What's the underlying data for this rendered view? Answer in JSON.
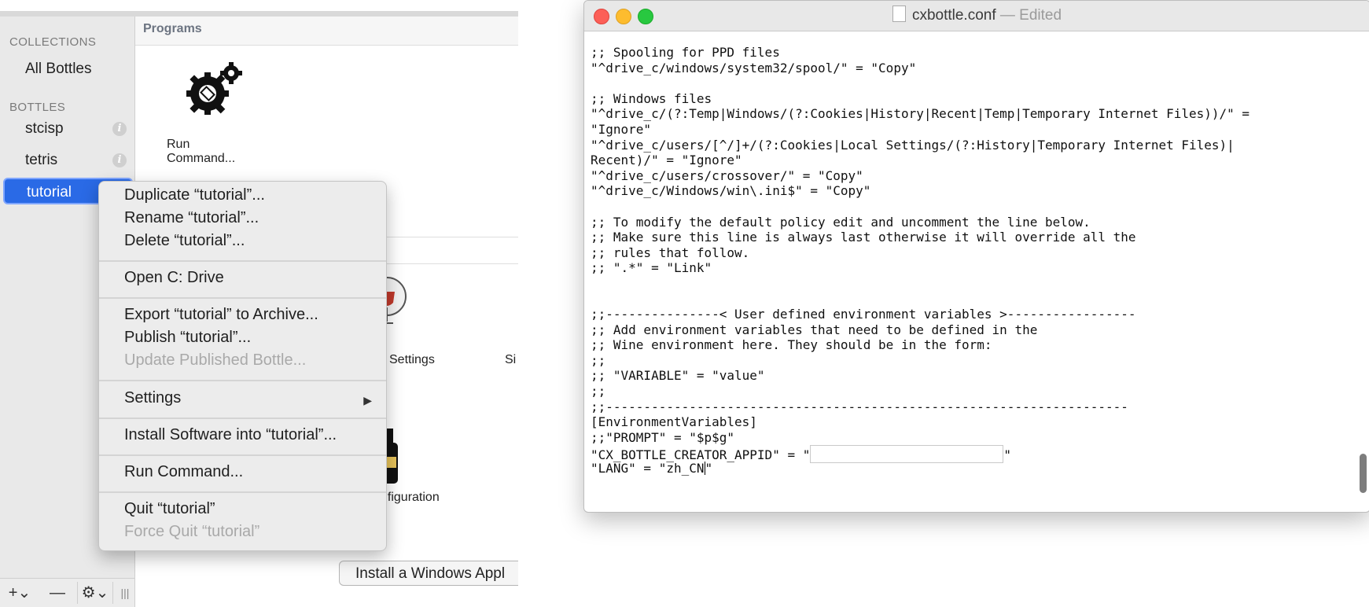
{
  "sidebar": {
    "collections_header": "COLLECTIONS",
    "all_bottles": "All Bottles",
    "bottles_header": "BOTTLES",
    "bottles": [
      {
        "label": "stcisp",
        "info": "i"
      },
      {
        "label": "tetris",
        "info": "i"
      },
      {
        "label": "tutorial"
      }
    ],
    "toolbar": {
      "add": "+⌄",
      "remove": "—",
      "gear": "⚙⌄",
      "resize": "|||"
    }
  },
  "content": {
    "programs_header": "Programs",
    "run_command_label": "Run Command...",
    "settings_label": "Settings",
    "si_label": "Si",
    "configuration_label": "nfiguration",
    "install_button": "Install a Windows Appl"
  },
  "context_menu": {
    "items": [
      {
        "label": "Duplicate “tutorial”...",
        "enabled": true
      },
      {
        "label": "Rename “tutorial”...",
        "enabled": true
      },
      {
        "label": "Delete “tutorial”...",
        "enabled": true
      },
      {
        "label": "Open C: Drive",
        "enabled": true
      },
      {
        "label": "Export “tutorial” to Archive...",
        "enabled": true
      },
      {
        "label": "Publish “tutorial”...",
        "enabled": true
      },
      {
        "label": "Update Published Bottle...",
        "enabled": false
      },
      {
        "label": "Settings",
        "enabled": true,
        "submenu_arrow": "▶"
      },
      {
        "label": "Install Software into “tutorial”...",
        "enabled": true
      },
      {
        "label": "Run Command...",
        "enabled": true
      },
      {
        "label": "Quit “tutorial”",
        "enabled": true
      },
      {
        "label": "Force Quit “tutorial”",
        "enabled": false
      }
    ]
  },
  "editor": {
    "filename": "cxbottle.conf",
    "status": " — Edited",
    "lines": [
      ";; Spooling for PPD files",
      "\"^drive_c/windows/system32/spool/\" = \"Copy\"",
      "",
      ";; Windows files",
      "\"^drive_c/(?:Temp|Windows/(?:Cookies|History|Recent|Temp|Temporary Internet Files))/\" =",
      "\"Ignore\"",
      "\"^drive_c/users/[^/]+/(?:Cookies|Local Settings/(?:History|Temporary Internet Files)|",
      "Recent)/\" = \"Ignore\"",
      "\"^drive_c/users/crossover/\" = \"Copy\"",
      "\"^drive_c/Windows/win\\.ini$\" = \"Copy\"",
      "",
      ";; To modify the default policy edit and uncomment the line below.",
      ";; Make sure this line is always last otherwise it will override all the",
      ";; rules that follow.",
      ";; \".*\" = \"Link\"",
      "",
      "",
      ";;---------------< User defined environment variables >-----------------",
      ";; Add environment variables that need to be defined in the",
      ";; Wine environment here. They should be in the form:",
      ";;",
      ";; \"VARIABLE\" = \"value\"",
      ";;",
      ";;---------------------------------------------------------------------",
      "[EnvironmentVariables]",
      ";;\"PROMPT\" = \"$p$g\""
    ],
    "appid_prefix": "\"CX_BOTTLE_CREATOR_APPID\" = \"",
    "appid_suffix": "\"",
    "lang_prefix": "\"LANG\" = \"zh_CN",
    "lang_suffix": "\""
  }
}
